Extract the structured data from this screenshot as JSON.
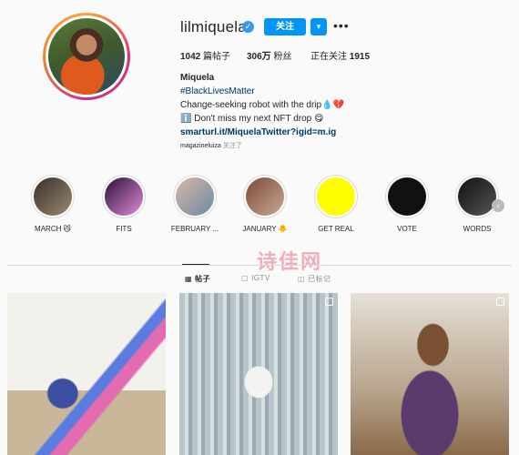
{
  "profile": {
    "username": "lilmiquela",
    "verified_mark": "✓",
    "follow_label": "关注",
    "dropdown_label": "▾",
    "more_label": "•••",
    "stats": {
      "posts_count": "1042",
      "posts_label": " 篇帖子",
      "followers_count": "306万",
      "followers_label": " 粉丝",
      "following_label": "正在关注 ",
      "following_count": "1915"
    },
    "bio": {
      "name": "Miquela",
      "hashtag": "#BlackLivesMatter",
      "line1": "Change-seeking robot with the drip💧💔",
      "line2": "ℹ️ Don't miss my next NFT drop 😋",
      "link": "smarturl.it/MiquelaTwitter?igid=m.ig"
    },
    "followed_by_user": "magazineluiza",
    "followed_by_suffix": " 关注了"
  },
  "highlights": [
    {
      "label": "MARCH 😼",
      "colors": [
        "#3a2e2a",
        "#9a8a70"
      ]
    },
    {
      "label": "FITS",
      "colors": [
        "#2a1030",
        "#e38adf"
      ]
    },
    {
      "label": "FEBRUARY ...",
      "colors": [
        "#d8b7a4",
        "#6a8aa5"
      ]
    },
    {
      "label": "JANUARY 🐥",
      "colors": [
        "#7a4a3a",
        "#caa794"
      ]
    },
    {
      "label": "GET REAL",
      "colors": [
        "#fffc00",
        "#fffc00"
      ]
    },
    {
      "label": "VOTE",
      "colors": [
        "#111111",
        "#111111"
      ]
    },
    {
      "label": "WORDS",
      "colors": [
        "#111111",
        "#555555"
      ]
    }
  ],
  "highlights_next": "›",
  "watermark": "诗佳网",
  "tabs": {
    "posts": "帖子",
    "igtv": "IGTV",
    "tagged": "已标记"
  }
}
